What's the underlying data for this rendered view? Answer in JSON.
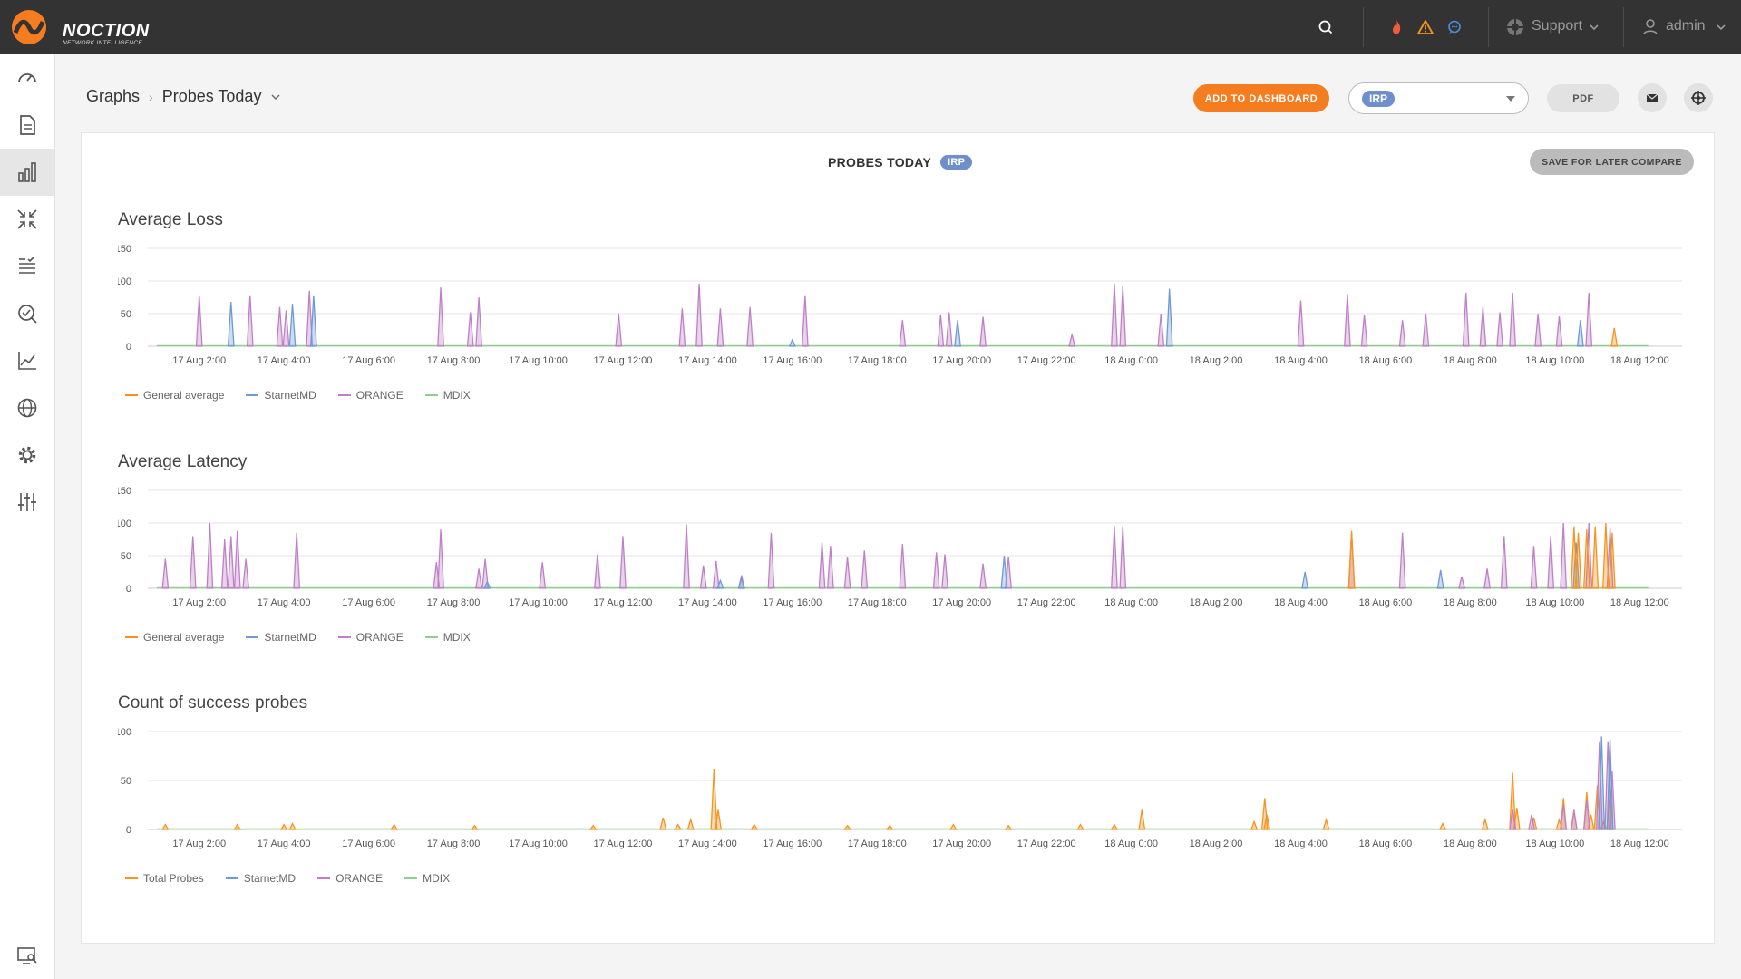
{
  "app": {
    "logo_text": "NOCTION",
    "logo_subtitle": "NETWORK INTELLIGENCE",
    "support_label": "Support",
    "user_label": "admin"
  },
  "colors": {
    "topbar": "#333333",
    "accent": "#f57c1f",
    "general_average": "#f7931e",
    "starnetmd": "#6e9ad6",
    "orange": "#c07fc8",
    "mdix": "#8fce8f"
  },
  "sidebar": {
    "items": [
      {
        "icon": "dashboard-gauge-icon"
      },
      {
        "icon": "report-document-icon"
      },
      {
        "icon": "graphs-bar-icon",
        "active": true
      },
      {
        "icon": "compress-arrows-icon"
      },
      {
        "icon": "checklist-icon"
      },
      {
        "icon": "search-check-icon"
      },
      {
        "icon": "line-chart-icon"
      },
      {
        "icon": "globe-icon"
      },
      {
        "icon": "settings-gear-icon"
      },
      {
        "icon": "sliders-icon"
      }
    ],
    "bottom_icon": "monitor-search-icon"
  },
  "breadcrumb": {
    "root": "Graphs",
    "current": "Probes Today"
  },
  "toolbar": {
    "add_to_dashboard": "ADD TO DASHBOARD",
    "selected_provider": "IRP",
    "pdf": "PDF"
  },
  "panel": {
    "title": "PROBES TODAY",
    "tag": "IRP",
    "save_button": "SAVE FOR LATER COMPARE"
  },
  "x_ticks": [
    "17 Aug 2:00",
    "17 Aug 4:00",
    "17 Aug 6:00",
    "17 Aug 8:00",
    "17 Aug 10:00",
    "17 Aug 12:00",
    "17 Aug 14:00",
    "17 Aug 16:00",
    "17 Aug 18:00",
    "17 Aug 20:00",
    "17 Aug 22:00",
    "18 Aug 0:00",
    "18 Aug 2:00",
    "18 Aug 4:00",
    "18 Aug 6:00",
    "18 Aug 8:00",
    "18 Aug 10:00",
    "18 Aug 12:00"
  ],
  "chart_data": [
    {
      "type": "area",
      "title": "Average Loss",
      "ylim": [
        0,
        150
      ],
      "yticks": [
        0,
        50,
        100,
        150
      ],
      "legend": [
        "General average",
        "StarnetMD",
        "ORANGE",
        "MDIX"
      ],
      "series": [
        {
          "name": "ORANGE",
          "spikes": [
            [
              1.0,
              78
            ],
            [
              2.2,
              78
            ],
            [
              2.9,
              60
            ],
            [
              3.05,
              55
            ],
            [
              3.6,
              85
            ],
            [
              6.7,
              90
            ],
            [
              7.4,
              52
            ],
            [
              7.6,
              75
            ],
            [
              10.9,
              50
            ],
            [
              12.4,
              58
            ],
            [
              12.8,
              96
            ],
            [
              13.3,
              58
            ],
            [
              14.0,
              60
            ],
            [
              15.3,
              78
            ],
            [
              17.6,
              40
            ],
            [
              18.5,
              48
            ],
            [
              18.7,
              52
            ],
            [
              19.5,
              45
            ],
            [
              21.6,
              18
            ],
            [
              22.6,
              96
            ],
            [
              22.8,
              92
            ],
            [
              23.7,
              50
            ],
            [
              27.0,
              70
            ],
            [
              28.1,
              80
            ],
            [
              28.5,
              48
            ],
            [
              29.4,
              40
            ],
            [
              29.95,
              50
            ],
            [
              30.9,
              82
            ],
            [
              31.3,
              60
            ],
            [
              31.7,
              52
            ],
            [
              32.0,
              82
            ],
            [
              32.6,
              50
            ],
            [
              33.1,
              46
            ],
            [
              33.8,
              82
            ]
          ]
        },
        {
          "name": "StarnetMD",
          "spikes": [
            [
              1.75,
              68
            ],
            [
              3.2,
              65
            ],
            [
              3.7,
              78
            ],
            [
              15.0,
              10
            ],
            [
              18.9,
              40
            ],
            [
              23.9,
              88
            ],
            [
              33.6,
              40
            ]
          ]
        },
        {
          "name": "General average",
          "spikes": [
            [
              34.4,
              28
            ]
          ]
        },
        {
          "name": "MDIX",
          "spikes": []
        }
      ]
    },
    {
      "type": "area",
      "title": "Average Latency",
      "ylim": [
        0,
        150
      ],
      "yticks": [
        0,
        50,
        100,
        150
      ],
      "legend": [
        "General average",
        "StarnetMD",
        "ORANGE",
        "MDIX"
      ],
      "series": [
        {
          "name": "ORANGE",
          "spikes": [
            [
              0.2,
              45
            ],
            [
              0.85,
              80
            ],
            [
              1.25,
              100
            ],
            [
              1.6,
              75
            ],
            [
              1.75,
              80
            ],
            [
              1.9,
              88
            ],
            [
              2.1,
              45
            ],
            [
              3.3,
              85
            ],
            [
              6.6,
              40
            ],
            [
              6.7,
              90
            ],
            [
              7.6,
              30
            ],
            [
              7.75,
              45
            ],
            [
              9.1,
              40
            ],
            [
              10.4,
              52
            ],
            [
              11.0,
              80
            ],
            [
              12.5,
              98
            ],
            [
              12.9,
              35
            ],
            [
              13.2,
              42
            ],
            [
              13.8,
              20
            ],
            [
              14.5,
              85
            ],
            [
              15.7,
              70
            ],
            [
              15.9,
              65
            ],
            [
              16.3,
              48
            ],
            [
              16.7,
              58
            ],
            [
              17.6,
              68
            ],
            [
              18.4,
              55
            ],
            [
              18.6,
              52
            ],
            [
              19.5,
              38
            ],
            [
              20.1,
              48
            ],
            [
              22.6,
              95
            ],
            [
              22.8,
              95
            ],
            [
              28.2,
              85
            ],
            [
              29.4,
              85
            ],
            [
              30.8,
              18
            ],
            [
              31.4,
              30
            ],
            [
              31.8,
              80
            ],
            [
              32.5,
              65
            ],
            [
              32.9,
              80
            ],
            [
              33.2,
              100
            ],
            [
              33.8,
              100
            ],
            [
              34.3,
              92
            ]
          ]
        },
        {
          "name": "StarnetMD",
          "spikes": [
            [
              7.8,
              10
            ],
            [
              13.3,
              12
            ],
            [
              13.8,
              15
            ],
            [
              20.0,
              50
            ],
            [
              27.1,
              25
            ],
            [
              30.3,
              28
            ],
            [
              33.5,
              70
            ]
          ]
        },
        {
          "name": "General average",
          "spikes": [
            [
              28.2,
              88
            ],
            [
              33.45,
              95
            ],
            [
              33.55,
              85
            ],
            [
              33.75,
              90
            ],
            [
              33.95,
              95
            ],
            [
              34.2,
              100
            ],
            [
              34.35,
              85
            ]
          ]
        },
        {
          "name": "MDIX",
          "spikes": []
        }
      ]
    },
    {
      "type": "area",
      "title": "Count of success probes",
      "ylim": [
        0,
        100
      ],
      "yticks": [
        0,
        50,
        100
      ],
      "legend": [
        "Total Probes",
        "StarnetMD",
        "ORANGE",
        "MDIX"
      ],
      "series": [
        {
          "name": "Total Probes",
          "spikes": [
            [
              0.2,
              5
            ],
            [
              1.9,
              5
            ],
            [
              3.0,
              5
            ],
            [
              3.2,
              6
            ],
            [
              5.6,
              5
            ],
            [
              7.5,
              4
            ],
            [
              10.3,
              4
            ],
            [
              11.95,
              12
            ],
            [
              12.3,
              5
            ],
            [
              12.6,
              10
            ],
            [
              13.15,
              62
            ],
            [
              13.25,
              20
            ],
            [
              14.1,
              5
            ],
            [
              16.3,
              4
            ],
            [
              17.3,
              4
            ],
            [
              18.8,
              5
            ],
            [
              20.1,
              4
            ],
            [
              21.8,
              5
            ],
            [
              22.6,
              5
            ],
            [
              23.25,
              20
            ],
            [
              25.9,
              8
            ],
            [
              26.15,
              32
            ],
            [
              26.2,
              15
            ],
            [
              27.6,
              10
            ],
            [
              30.35,
              6
            ],
            [
              31.35,
              10
            ],
            [
              32.0,
              58
            ],
            [
              32.1,
              22
            ],
            [
              32.5,
              12
            ],
            [
              33.1,
              10
            ],
            [
              33.2,
              32
            ],
            [
              33.45,
              18
            ],
            [
              33.75,
              38
            ],
            [
              33.85,
              15
            ],
            [
              34.0,
              45
            ],
            [
              34.15,
              8
            ],
            [
              34.3,
              40
            ]
          ]
        },
        {
          "name": "ORANGE",
          "spikes": [
            [
              32.0,
              20
            ],
            [
              32.45,
              15
            ],
            [
              33.2,
              25
            ],
            [
              33.45,
              20
            ],
            [
              33.75,
              30
            ],
            [
              34.05,
              90
            ],
            [
              34.25,
              90
            ],
            [
              34.35,
              60
            ]
          ]
        },
        {
          "name": "StarnetMD",
          "spikes": [
            [
              34.1,
              95
            ],
            [
              34.3,
              92
            ]
          ]
        },
        {
          "name": "MDIX",
          "spikes": []
        }
      ]
    }
  ]
}
